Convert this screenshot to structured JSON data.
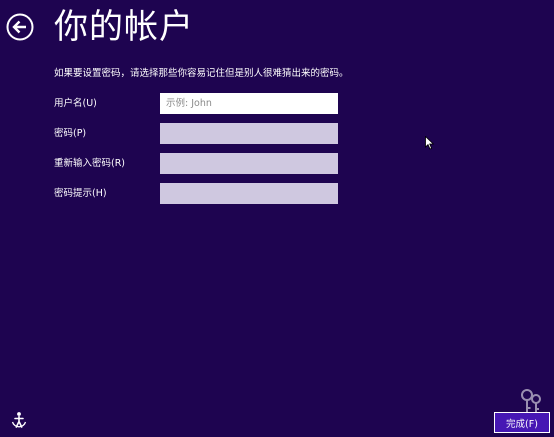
{
  "header": {
    "title": "你的帐户"
  },
  "instructions": "如果要设置密码，请选择那些你容易记住但是别人很难猜出来的密码。",
  "form": {
    "username": {
      "label": "用户名(U)",
      "placeholder": "示例: John",
      "value": ""
    },
    "password": {
      "label": "密码(P)",
      "value": ""
    },
    "confirm_password": {
      "label": "重新输入密码(R)",
      "value": ""
    },
    "password_hint": {
      "label": "密码提示(H)",
      "value": ""
    }
  },
  "footer": {
    "finish_label": "完成(F)"
  },
  "icons": {
    "back": "back-arrow-circle-icon",
    "ease_of_access": "ease-of-access-icon",
    "cursor": "mouse-pointer-icon",
    "keys": "keys-icon"
  },
  "colors": {
    "background": "#1e0450",
    "field": "#cfc8e0",
    "button": "#4617b4",
    "text": "#ffffff"
  }
}
